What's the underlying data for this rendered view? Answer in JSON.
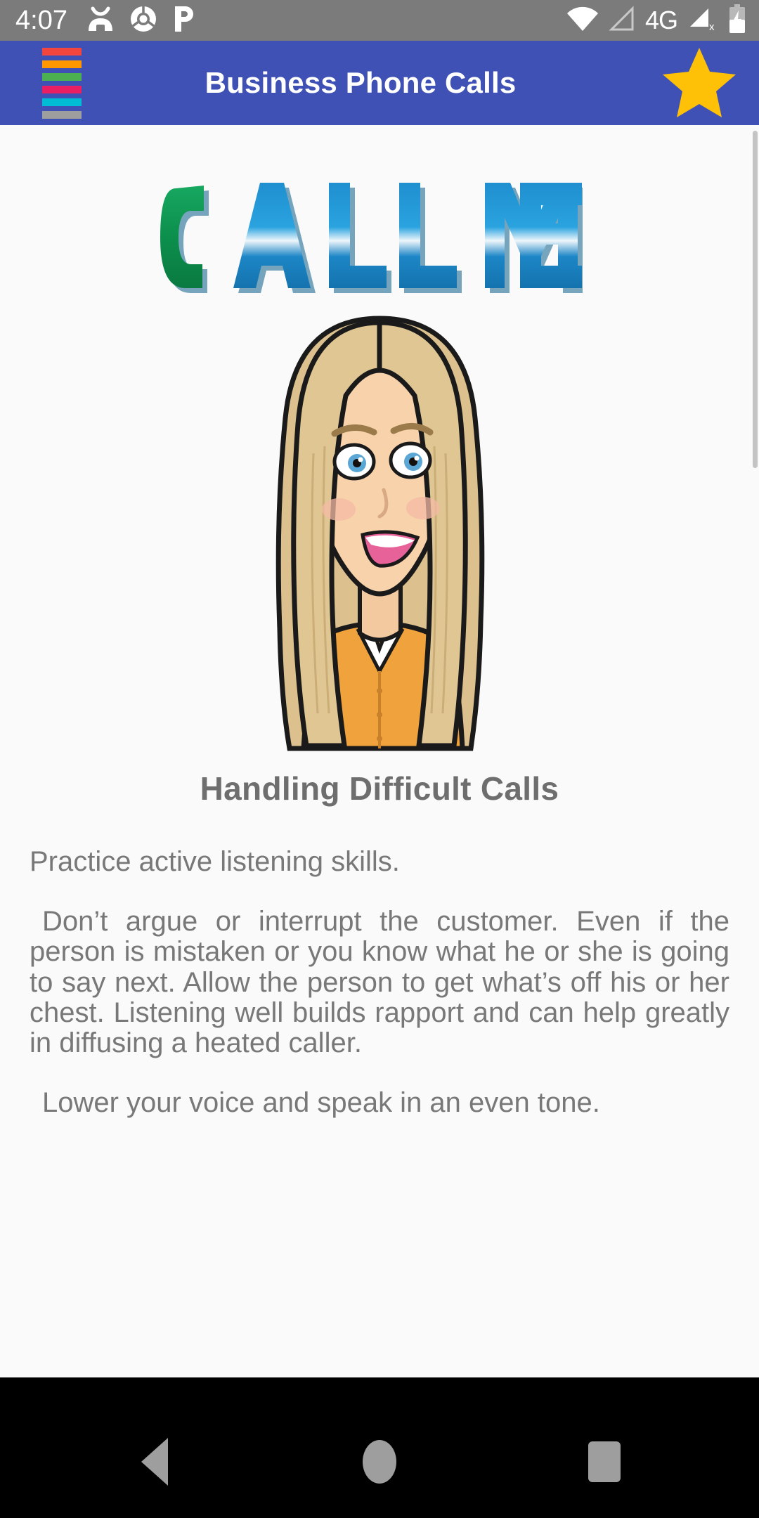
{
  "statusbar": {
    "time": "4:07",
    "network_label": "4G",
    "left_icons": [
      "contact-silhouette-icon",
      "chrome-icon",
      "pandora-p-icon"
    ],
    "right_icons": [
      "wifi-icon",
      "signal-outline-icon",
      "4g-label",
      "signal-no-service-icon",
      "battery-charging-icon"
    ],
    "background_color": "#7b7b7b",
    "foreground_color": "#ffffff"
  },
  "appbar": {
    "title": "Business Phone Calls",
    "background_color": "#3f51b5",
    "title_color": "#ffffff",
    "menu_icon": "hamburger-menu-icon",
    "menu_stripe_colors": [
      "#f1453d",
      "#ff9800",
      "#4caf50",
      "#e91e63",
      "#00bcd4",
      "#9e9e9e"
    ],
    "action_icon": "star-favorite-icon",
    "action_icon_color": "#ffc107"
  },
  "content": {
    "background_color": "#fafafa",
    "hero_image": {
      "name": "call-me-banner-image",
      "word_one": "CALL",
      "word_two": "ME",
      "word_one_first_letter_color": "#0e9c54",
      "word_color": "#1287c6"
    },
    "avatar_image": {
      "name": "bitmoji-woman-avatar",
      "hair_color": "#d9bc8a",
      "shirt_color": "#f0a33c",
      "skin_color": "#f3c9a0"
    },
    "section_title": "Handling Difficult Calls",
    "section_title_color": "#6e6e6e",
    "body_color": "#787878",
    "paragraphs": [
      "Practice active listening skills.",
      " Don’t argue or interrupt the customer. Even if the person is mistaken or you know what he or she is going to say next. Allow the person to get what’s off his or her chest. Listening well builds rapport and can help greatly in diffusing a heated caller.",
      " Lower your voice and speak in an even tone."
    ]
  },
  "navbar": {
    "background_color": "#000000",
    "icon_color": "#9e9e9e",
    "buttons": [
      "back-nav-button",
      "home-nav-button",
      "recents-nav-button"
    ]
  }
}
